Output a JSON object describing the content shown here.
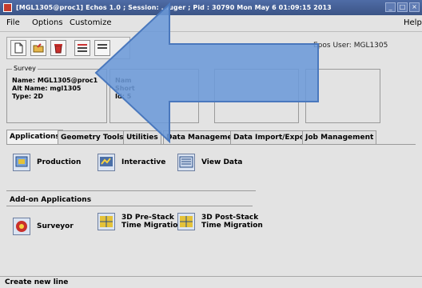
{
  "window": {
    "title": "[MGL1305@proc1] Echos 1.0 ; Session: ...uger ; Pid : 30790   Mon May  6 01:09:15 2013"
  },
  "menu": {
    "file": "File",
    "options": "Options",
    "customize": "Customize",
    "help": "Help"
  },
  "header": {
    "mode_user": "Epos User: MGL1305"
  },
  "survey": {
    "legend": "Survey",
    "name": "Name: MGL1305@proc1",
    "alt_name": "Alt Name: mgl1305",
    "type": "Type: 2D"
  },
  "project": {
    "name": "Nam",
    "short": "Short",
    "id": "Id: 5"
  },
  "tabs": [
    {
      "label": "Applications"
    },
    {
      "label": "Geometry Tools"
    },
    {
      "label": "Utilities"
    },
    {
      "label": "Data Management"
    },
    {
      "label": "Data Import/Export"
    },
    {
      "label": "Job Management"
    }
  ],
  "applications": {
    "production": "Production",
    "interactive": "Interactive",
    "view_data": "View Data"
  },
  "addons": {
    "heading": "Add-on Applications",
    "surveyor": "Surveyor",
    "prestack_l1": "3D Pre-Stack",
    "prestack_l2": "Time Migration",
    "poststack_l1": "3D Post-Stack",
    "poststack_l2": "Time Migration"
  },
  "status": {
    "text": "Create new line"
  },
  "colors": {
    "titlebar": "#3b5486",
    "arrow_fill": "#6c9ad8",
    "arrow_stroke": "#4a78bd"
  }
}
